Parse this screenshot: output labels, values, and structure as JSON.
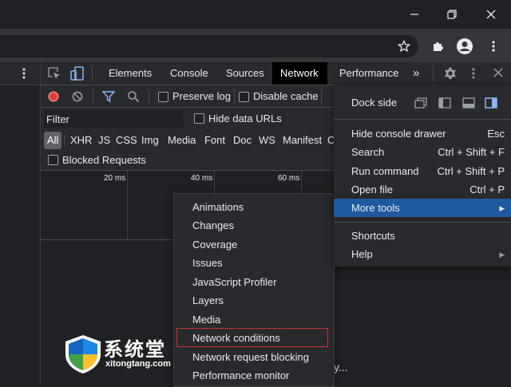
{
  "browser": {
    "minimize_icon": "minimize-icon",
    "restore_icon": "restore-icon",
    "close_icon": "close-icon",
    "star_icon": "bookmark-star-icon",
    "extensions_icon": "extensions-puzzle-icon",
    "profile_icon": "profile-avatar-icon",
    "menu_icon": "kebab-menu-icon"
  },
  "devtools": {
    "tabs": [
      {
        "label": "Elements"
      },
      {
        "label": "Console"
      },
      {
        "label": "Sources"
      },
      {
        "label": "Network",
        "active": true
      },
      {
        "label": "Performance"
      }
    ],
    "more_tabs": "»",
    "network_toolbar": {
      "preserve_log": "Preserve log",
      "disable_cache": "Disable cache"
    },
    "filter": {
      "placeholder": "Filter",
      "hide_data_urls": "Hide data URLs"
    },
    "types": [
      "All",
      "XHR",
      "JS",
      "CSS",
      "Img",
      "Media",
      "Font",
      "Doc",
      "WS",
      "Manifest",
      "Ot"
    ],
    "blocked_requests": "Blocked Requests",
    "timeline_ticks": [
      "20 ms",
      "40 ms",
      "60 ms"
    ]
  },
  "main_menu": {
    "dock_side": "Dock side",
    "items": [
      {
        "label": "Hide console drawer",
        "shortcut": "Esc"
      },
      {
        "label": "Search",
        "shortcut": "Ctrl + Shift + F"
      },
      {
        "label": "Run command",
        "shortcut": "Ctrl + Shift + P"
      },
      {
        "label": "Open file",
        "shortcut": "Ctrl + P"
      },
      {
        "label": "More tools",
        "shortcut": "▸",
        "active": true
      }
    ],
    "items2": [
      {
        "label": "Shortcuts",
        "shortcut": ""
      },
      {
        "label": "Help",
        "shortcut": "▸"
      }
    ]
  },
  "more_tools_menu": [
    "Animations",
    "Changes",
    "Coverage",
    "Issues",
    "JavaScript Profiler",
    "Layers",
    "Media",
    "Network conditions",
    "Network request blocking",
    "Performance monitor"
  ],
  "watermark": {
    "text": "系统堂",
    "url": "xitongtang.com"
  },
  "background_text": "y..."
}
